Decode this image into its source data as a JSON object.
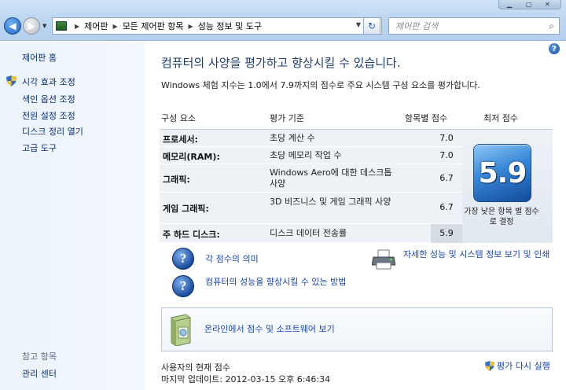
{
  "address": {
    "crumbs": [
      "제어판",
      "모든 제어판 항목",
      "성능 정보 및 도구"
    ],
    "search_placeholder": "제어판 검색"
  },
  "sidebar": {
    "home": "제어판 홈",
    "items": [
      "시각 효과 조정",
      "색인 옵션 조정",
      "전원 설정 조정",
      "디스크 정리 열기",
      "고급 도구"
    ],
    "see_also": "참고 항목",
    "see_also_items": [
      "관리 센터"
    ]
  },
  "main": {
    "title": "컴퓨터의 사양을 평가하고 향상시킬 수 있습니다.",
    "subtitle": "Windows 체험 지수는 1.0에서 7.9까지의 점수로 주요 시스템 구성 요소를 평가합니다.",
    "headers": {
      "component": "구성 요소",
      "rated": "평가 기준",
      "subscore": "항목별 점수",
      "base": "최저 점수"
    },
    "rows": [
      {
        "component": "프로세서:",
        "rated": "초당 계산 수",
        "score": "7.0"
      },
      {
        "component": "메모리(RAM):",
        "rated": "초당 메모리 작업 수",
        "score": "7.0"
      },
      {
        "component": "그래픽:",
        "rated": "Windows Aero에 대한 데스크톱 사양",
        "score": "6.7"
      },
      {
        "component": "게임 그래픽:",
        "rated": "3D 비즈니스 및 게임 그래픽 사양",
        "score": "6.7"
      },
      {
        "component": "주 하드 디스크:",
        "rated": "디스크 데이터 전송률",
        "score": "5.9"
      }
    ],
    "base_score": "5.9",
    "base_caption": "가장 낮은 항목 별 점수로 결정",
    "links": {
      "meaning": "각 점수의 의미",
      "improve": "컴퓨터의 성능을 향상시킬 수 있는 방법",
      "details": "자세한 성능 및 시스템 정보 보기 및 인쇄",
      "online": "온라인에서 점수 및 소프트웨어 보기"
    },
    "current_label": "사용자의 현재 점수",
    "last_update": "마지막 업데이트: 2012-03-15 오후 6:46:34",
    "rerun": "평가 다시 실행"
  }
}
